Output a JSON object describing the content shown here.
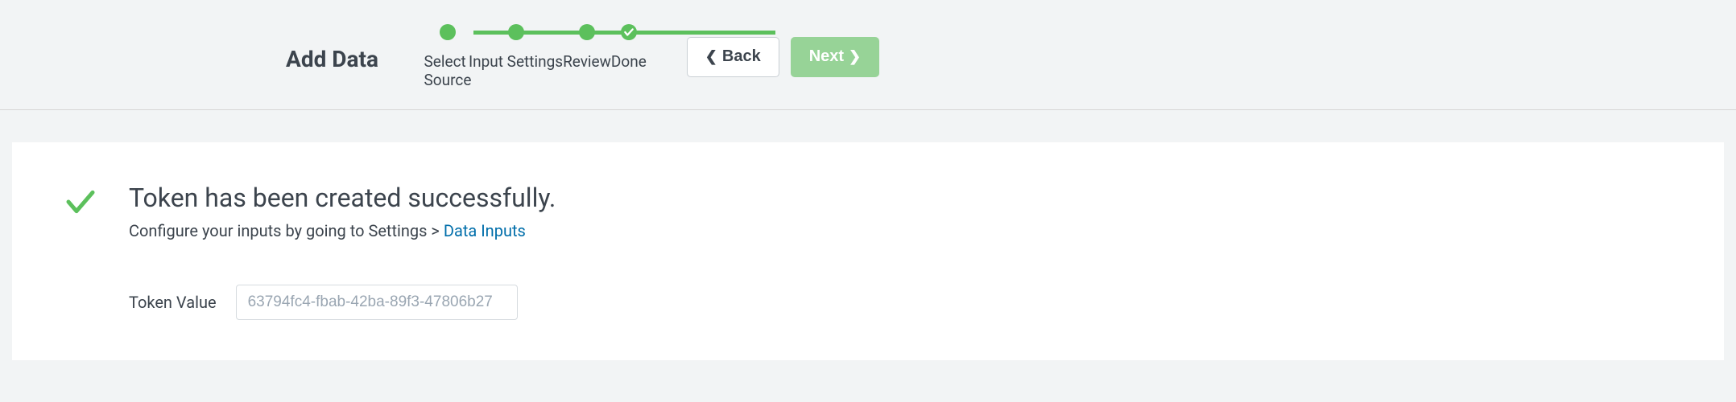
{
  "header": {
    "title": "Add Data",
    "steps": [
      {
        "label": "Select Source"
      },
      {
        "label": "Input Settings"
      },
      {
        "label": "Review"
      },
      {
        "label": "Done"
      }
    ],
    "back_label": "Back",
    "next_label": "Next"
  },
  "main": {
    "success_title": "Token has been created successfully.",
    "subtext_prefix": "Configure your inputs by going to Settings > ",
    "subtext_link": "Data Inputs",
    "token_label": "Token Value",
    "token_value": "63794fc4-fbab-42ba-89f3-47806b27"
  }
}
